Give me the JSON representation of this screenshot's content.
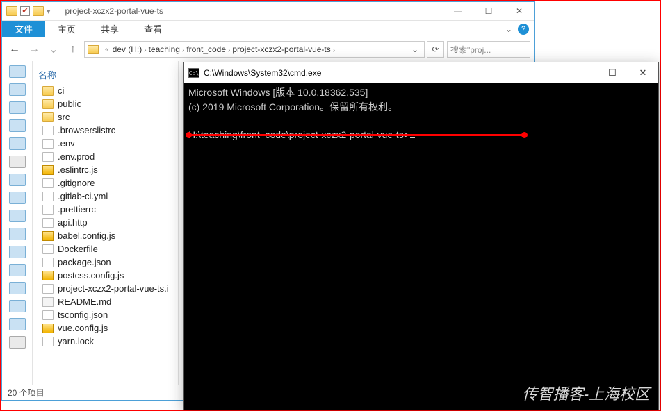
{
  "explorer": {
    "title": "project-xczx2-portal-vue-ts",
    "ribbon": {
      "file": "文件",
      "home": "主页",
      "share": "共享",
      "view": "查看"
    },
    "breadcrumbs": [
      "dev (H:)",
      "teaching",
      "front_code",
      "project-xczx2-portal-vue-ts"
    ],
    "search_placeholder": "搜索\"proj...",
    "tree_header": "名称",
    "items": [
      {
        "name": "ci",
        "type": "folder"
      },
      {
        "name": "public",
        "type": "folder"
      },
      {
        "name": "src",
        "type": "folder"
      },
      {
        "name": ".browserslistrc",
        "type": "file"
      },
      {
        "name": ".env",
        "type": "file"
      },
      {
        "name": ".env.prod",
        "type": "file"
      },
      {
        "name": ".eslintrc.js",
        "type": "js"
      },
      {
        "name": ".gitignore",
        "type": "file"
      },
      {
        "name": ".gitlab-ci.yml",
        "type": "file"
      },
      {
        "name": ".prettierrc",
        "type": "file"
      },
      {
        "name": "api.http",
        "type": "file"
      },
      {
        "name": "babel.config.js",
        "type": "js"
      },
      {
        "name": "Dockerfile",
        "type": "file"
      },
      {
        "name": "package.json",
        "type": "file"
      },
      {
        "name": "postcss.config.js",
        "type": "js"
      },
      {
        "name": "project-xczx2-portal-vue-ts.i",
        "type": "file"
      },
      {
        "name": "README.md",
        "type": "md"
      },
      {
        "name": "tsconfig.json",
        "type": "file"
      },
      {
        "name": "vue.config.js",
        "type": "js"
      },
      {
        "name": "yarn.lock",
        "type": "file"
      }
    ],
    "status": "20 个项目"
  },
  "cmd": {
    "title": "C:\\Windows\\System32\\cmd.exe",
    "line1": "Microsoft Windows [版本 10.0.18362.535]",
    "line2": "(c) 2019 Microsoft Corporation。保留所有权利。",
    "prompt": "H:\\teaching\\front_code\\project-xczx2-portal-vue-ts>"
  },
  "watermark": "传智播客-上海校区",
  "glyphs": {
    "back": "←",
    "fwd": "→",
    "up": "↑",
    "down": "⌄",
    "caret": "›",
    "refresh": "⟳",
    "min": "—",
    "max": "☐",
    "close": "✕",
    "chev": "⌄",
    "help": "?",
    "check": "✔",
    "ellipsis": "«"
  }
}
